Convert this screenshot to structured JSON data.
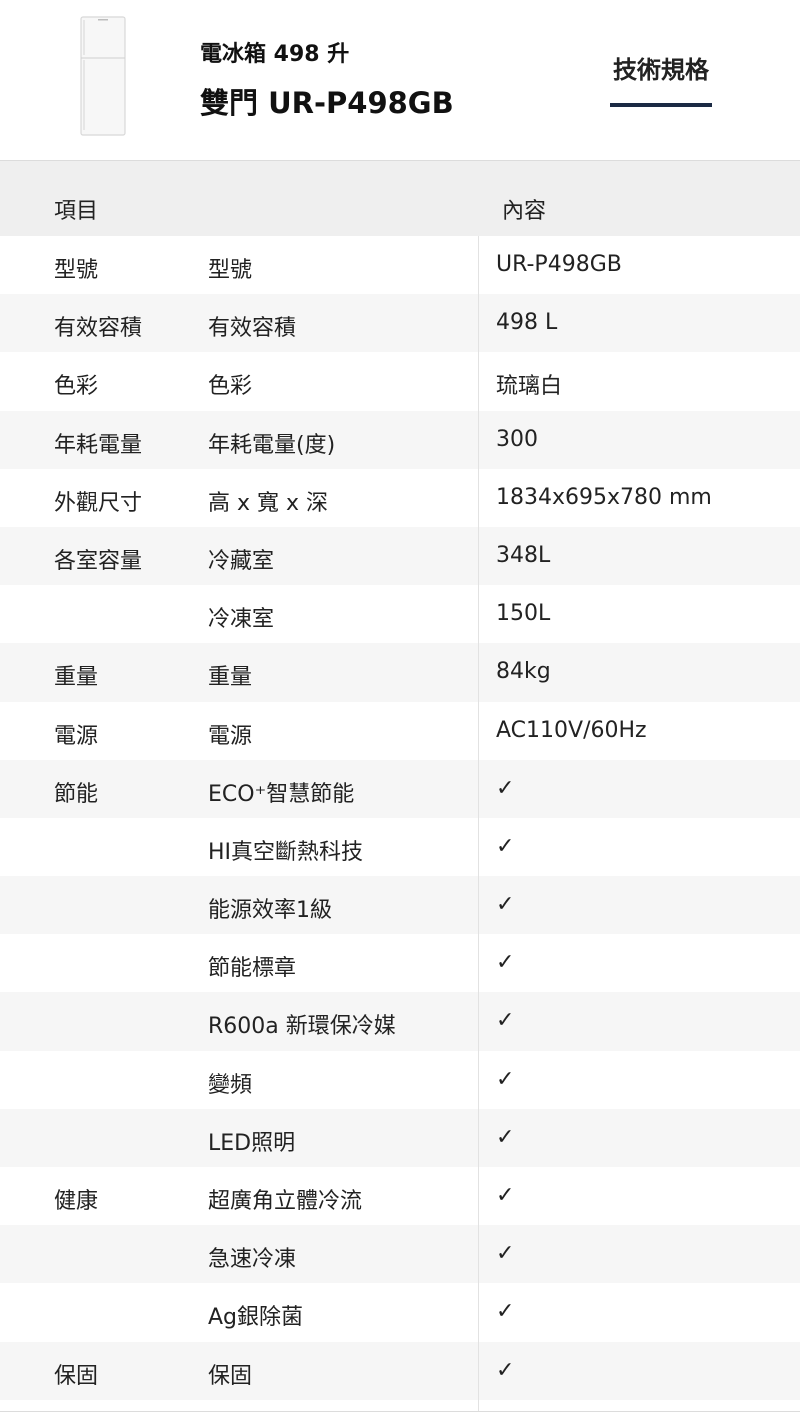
{
  "header": {
    "title_line1": "電冰箱  498 升",
    "title_line2": "雙門  UR-P498GB",
    "tab_label": "技術規格"
  },
  "table": {
    "col_item": "項目",
    "col_content": "內容",
    "rows": [
      {
        "category": "型號",
        "item": "型號",
        "value": "UR-P498GB"
      },
      {
        "category": "有效容積",
        "item": "有效容積",
        "value": "498 L"
      },
      {
        "category": "色彩",
        "item": "色彩",
        "value": "琉璃白"
      },
      {
        "category": "年耗電量",
        "item": "年耗電量(度)",
        "value": "300"
      },
      {
        "category": "外觀尺寸",
        "item": "高 x 寬 x 深",
        "value": "1834x695x780 mm"
      },
      {
        "category": "各室容量",
        "item": "冷藏室",
        "value": "348L"
      },
      {
        "category": "",
        "item": "冷凍室",
        "value": "150L"
      },
      {
        "category": "重量",
        "item": "重量",
        "value": "84kg"
      },
      {
        "category": "電源",
        "item": "電源",
        "value": "AC110V/60Hz"
      },
      {
        "category": "節能",
        "item": "ECO⁺智慧節能",
        "value": "✓"
      },
      {
        "category": "",
        "item": "HI真空斷熱科技",
        "value": "✓"
      },
      {
        "category": "",
        "item": "能源效率1級",
        "value": "✓"
      },
      {
        "category": "",
        "item": "節能標章",
        "value": "✓"
      },
      {
        "category": "",
        "item": "R600a 新環保冷媒",
        "value": "✓"
      },
      {
        "category": "",
        "item": "變頻",
        "value": "✓"
      },
      {
        "category": "",
        "item": "LED照明",
        "value": "✓"
      },
      {
        "category": "健康",
        "item": "超廣角立體冷流",
        "value": "✓"
      },
      {
        "category": "",
        "item": "急速冷凍",
        "value": "✓"
      },
      {
        "category": "",
        "item": "Ag銀除菌",
        "value": "✓"
      },
      {
        "category": "保固",
        "item": "保固",
        "value": "✓"
      }
    ]
  },
  "icons": {
    "product": "refrigerator-image",
    "check": "checkmark-icon"
  },
  "colors": {
    "accent": "#1b2a44",
    "header_bg": "#efefef",
    "stripe_bg": "#f6f6f6"
  }
}
